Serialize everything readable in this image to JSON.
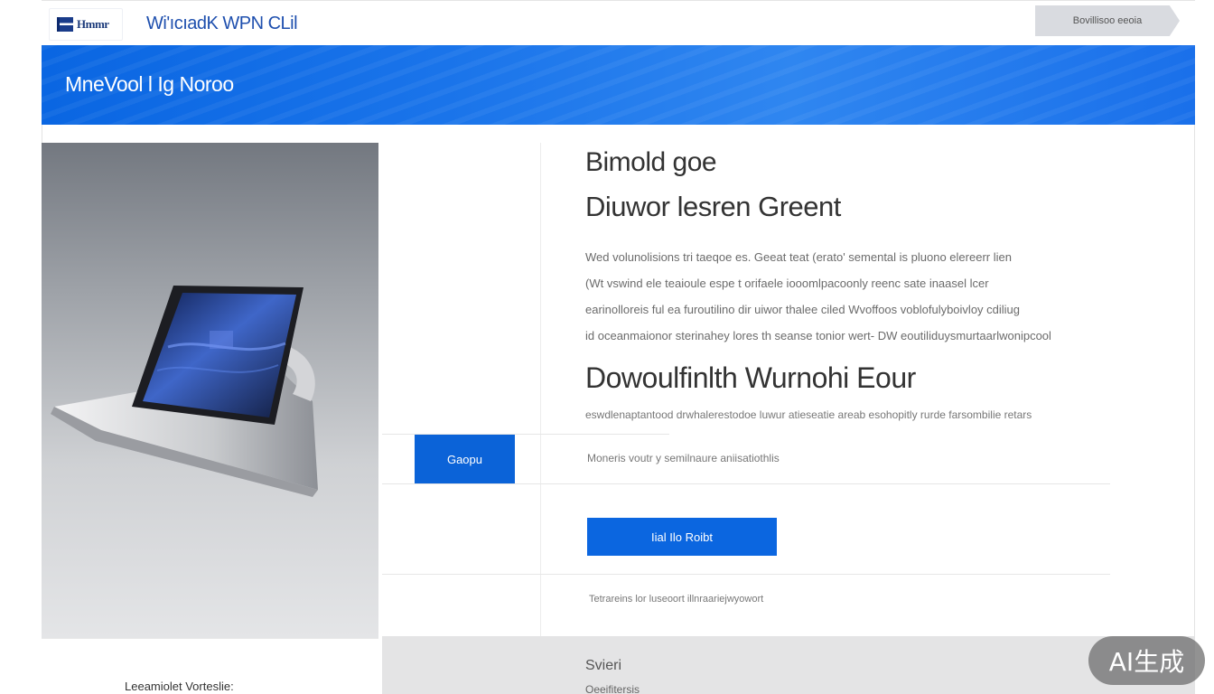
{
  "header": {
    "logo_text": "Hmmr",
    "site_title": "Wi'ıcıadK WPN CLil",
    "cta_label": "Bovillisoo eeoia"
  },
  "banner": {
    "title": "MneVool l Ig Noroo"
  },
  "product": {
    "caption": "Leeamiolet Vorteslie:"
  },
  "tabs": {
    "active_label": "Gaopu"
  },
  "content": {
    "heading_line1": "Bimold goe",
    "heading_line2": "Diuwor lesren Greent",
    "paragraph_lines": [
      "Wed volunolisions tri taeqoe es. Geeat teat (erato' semental is pluono elereerr lien",
      "(Wt vswind ele teaioule espe t orifaele iooomlpacoonly reenc sate inaasel lcer",
      "earinolloreis ful ea furoutilino dir uiwor thalee ciled Wvoffoos voblofulyboivloy cdiliug",
      "id oceanmaionor sterinahey lores th seanse tonior wert- DW eoutiliduysmurtaarlwonipcool"
    ],
    "heading3": "Dowoulfinlth Wurnohi Eour",
    "subline": "eswdlenaptantood drwhalerestodoe luwur atieseatie areab esohopitly rurde farsombilie retars",
    "tagline": "Moneris voutr y semilnaure aniisatiothlis",
    "primary_button": "Iial Ilo Roibt",
    "footnote": "Tetrareins lor luseoort illnraariejwyowort"
  },
  "bottom": {
    "title": "Svieri",
    "subtitle": "Oeeifitersis"
  },
  "watermark": {
    "label": "AI生成"
  },
  "colors": {
    "brand_blue": "#0b66e0",
    "banner_blue": "#1a74ea",
    "header_text_blue": "#1e4fae"
  }
}
